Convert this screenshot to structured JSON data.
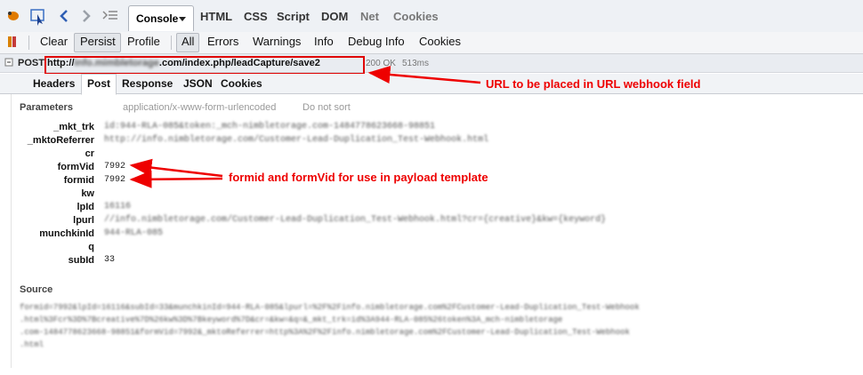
{
  "toolbar": {
    "tabs": [
      {
        "label": "Console",
        "active": true
      },
      {
        "label": "HTML"
      },
      {
        "label": "CSS"
      },
      {
        "label": "Script"
      },
      {
        "label": "DOM"
      },
      {
        "label": "Net",
        "dim": true
      },
      {
        "label": "Cookies",
        "dim": true
      }
    ]
  },
  "console_bar": {
    "clear": "Clear",
    "persist": "Persist",
    "profile": "Profile",
    "filters": [
      "All",
      "Errors",
      "Warnings",
      "Info",
      "Debug Info",
      "Cookies"
    ]
  },
  "request": {
    "method": "POST",
    "url_prefix": "http://",
    "url_host_hidden": "info.mimbletorage",
    "url_rest": ".com/index.php/leadCapture/save2",
    "status": "200 OK",
    "time": "513ms"
  },
  "subtabs": [
    "Headers",
    "Post",
    "Response",
    "JSON",
    "Cookies"
  ],
  "parameters": {
    "title": "Parameters",
    "content_type": "application/x-www-form-urlencoded",
    "sort": "Do not sort",
    "rows": [
      {
        "key": "_mkt_trk",
        "value": "id:944-RLA-085&token:_mch-nimbletorage.com-1484778623668-98851"
      },
      {
        "key": "_mktoReferrer",
        "value": "http://info.nimbletorage.com/Customer-Lead-Duplication_Test-Webhook.html"
      },
      {
        "key": "cr",
        "value": ""
      },
      {
        "key": "formVid",
        "value": "7992"
      },
      {
        "key": "formid",
        "value": "7992"
      },
      {
        "key": "kw",
        "value": ""
      },
      {
        "key": "lpId",
        "value": "16116"
      },
      {
        "key": "lpurl",
        "value": "//info.nimbletorage.com/Customer-Lead-Duplication_Test-Webhook.html?cr={creative}&kw={keyword}"
      },
      {
        "key": "munchkinId",
        "value": "944-RLA-085"
      },
      {
        "key": "q",
        "value": ""
      },
      {
        "key": "subId",
        "value": "33"
      }
    ]
  },
  "source": {
    "title": "Source",
    "lines": [
      "formid=7992&lpId=16116&subId=33&munchkinId=944-RLA-085&lpurl=%2F%2Finfo.nimbletorage.com%2FCustomer-Lead-Duplication_Test-Webhook",
      ".html%3Fcr%3D%7Bcreative%7D%26kw%3D%7Bkeyword%7D&cr=&kw=&q=&_mkt_trk=id%3A944-RLA-085%26token%3A_mch-nimbletorage",
      ".com-1484778623668-98851&formVid=7992&_mktoReferrer=http%3A%2F%2Finfo.nimbletorage.com%2FCustomer-Lead-Duplication_Test-Webhook",
      ".html"
    ]
  },
  "annotations": {
    "url": "URL to be placed in URL webhook field",
    "form": "formid and formVid for use in payload template",
    "color": "#ee0000"
  }
}
